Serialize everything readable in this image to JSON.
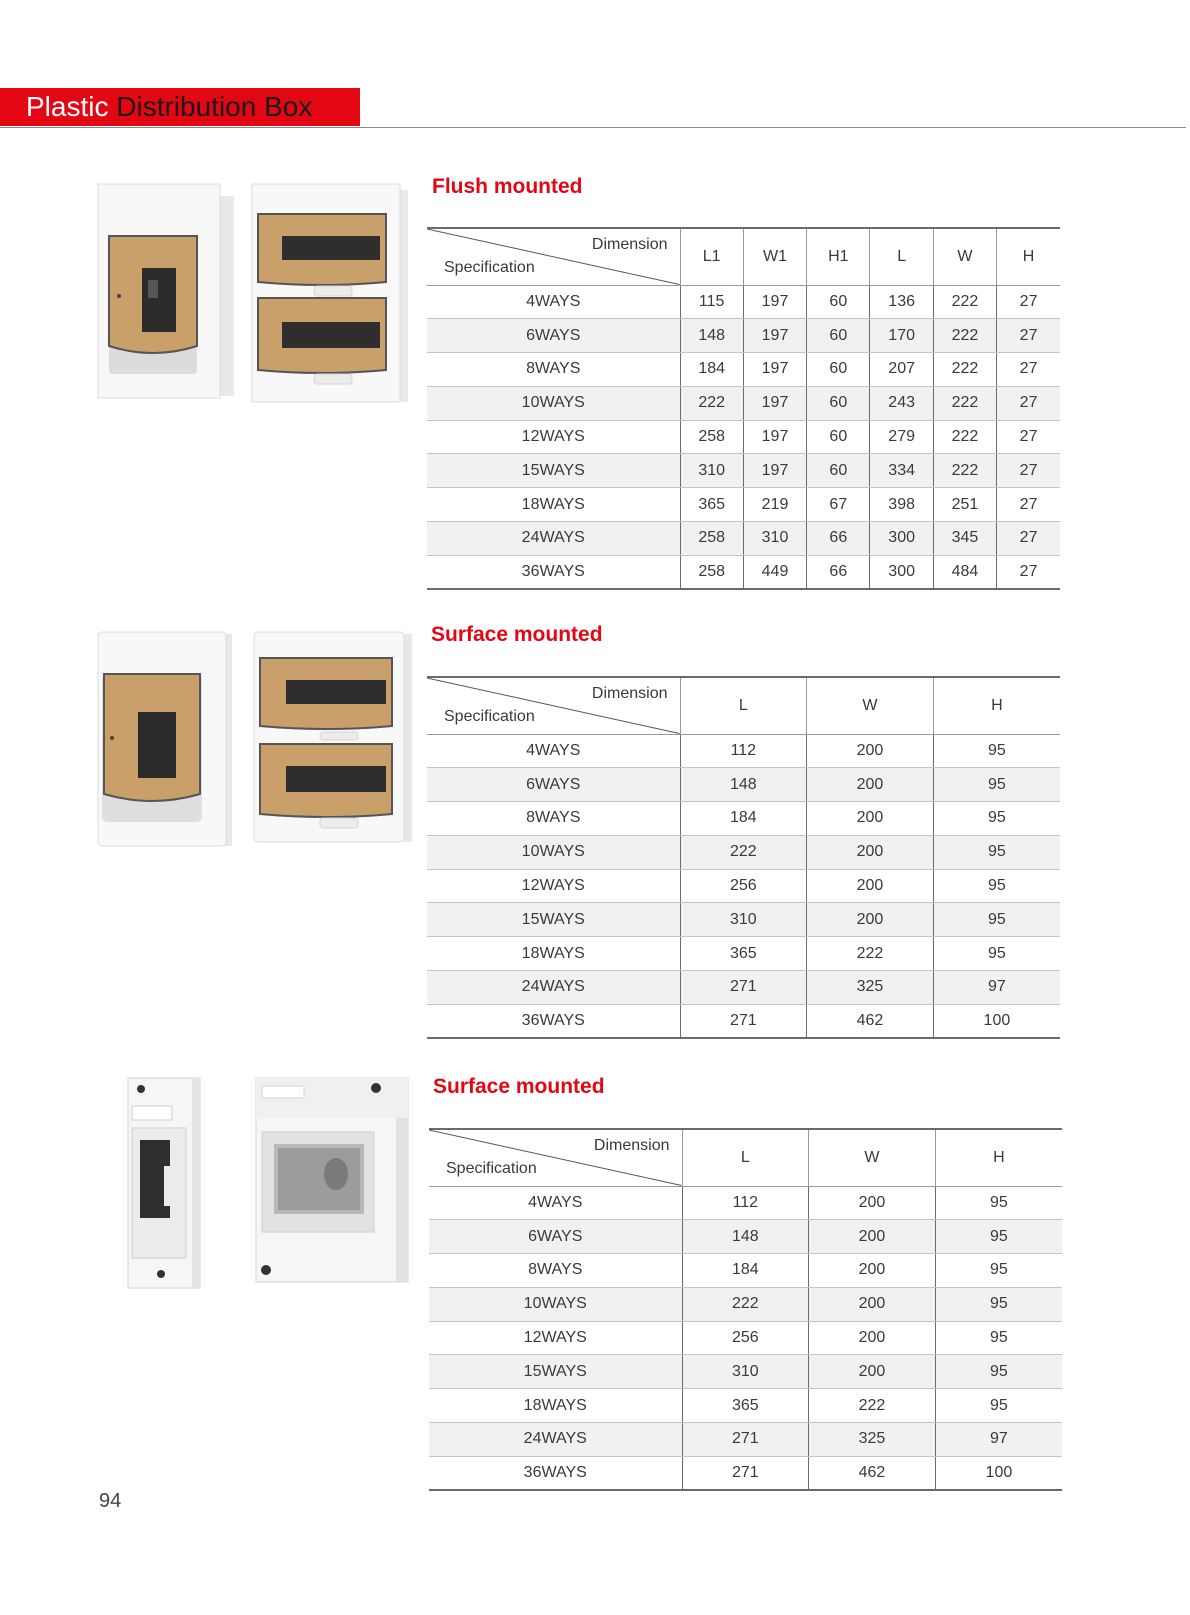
{
  "header": {
    "title_part1": "Plastic",
    "title_part2": "Distribution Box"
  },
  "sections": [
    {
      "title": "Flush mounted",
      "header_dimension": "Dimension",
      "header_specification": "Specification",
      "columns": [
        "L1",
        "W1",
        "H1",
        "L",
        "W",
        "H"
      ],
      "rows": [
        [
          "4WAYS",
          "115",
          "197",
          "60",
          "136",
          "222",
          "27"
        ],
        [
          "6WAYS",
          "148",
          "197",
          "60",
          "170",
          "222",
          "27"
        ],
        [
          "8WAYS",
          "184",
          "197",
          "60",
          "207",
          "222",
          "27"
        ],
        [
          "10WAYS",
          "222",
          "197",
          "60",
          "243",
          "222",
          "27"
        ],
        [
          "12WAYS",
          "258",
          "197",
          "60",
          "279",
          "222",
          "27"
        ],
        [
          "15WAYS",
          "310",
          "197",
          "60",
          "334",
          "222",
          "27"
        ],
        [
          "18WAYS",
          "365",
          "219",
          "67",
          "398",
          "251",
          "27"
        ],
        [
          "24WAYS",
          "258",
          "310",
          "66",
          "300",
          "345",
          "27"
        ],
        [
          "36WAYS",
          "258",
          "449",
          "66",
          "300",
          "484",
          "27"
        ]
      ]
    },
    {
      "title": "Surface mounted",
      "header_dimension": "Dimension",
      "header_specification": "Specification",
      "columns": [
        "L",
        "W",
        "H"
      ],
      "rows": [
        [
          "4WAYS",
          "112",
          "200",
          "95"
        ],
        [
          "6WAYS",
          "148",
          "200",
          "95"
        ],
        [
          "8WAYS",
          "184",
          "200",
          "95"
        ],
        [
          "10WAYS",
          "222",
          "200",
          "95"
        ],
        [
          "12WAYS",
          "256",
          "200",
          "95"
        ],
        [
          "15WAYS",
          "310",
          "200",
          "95"
        ],
        [
          "18WAYS",
          "365",
          "222",
          "95"
        ],
        [
          "24WAYS",
          "271",
          "325",
          "97"
        ],
        [
          "36WAYS",
          "271",
          "462",
          "100"
        ]
      ]
    },
    {
      "title": "Surface mounted",
      "header_dimension": "Dimension",
      "header_specification": "Specification",
      "columns": [
        "L",
        "W",
        "H"
      ],
      "rows": [
        [
          "4WAYS",
          "112",
          "200",
          "95"
        ],
        [
          "6WAYS",
          "148",
          "200",
          "95"
        ],
        [
          "8WAYS",
          "184",
          "200",
          "95"
        ],
        [
          "10WAYS",
          "222",
          "200",
          "95"
        ],
        [
          "12WAYS",
          "256",
          "200",
          "95"
        ],
        [
          "15WAYS",
          "310",
          "200",
          "95"
        ],
        [
          "18WAYS",
          "365",
          "222",
          "95"
        ],
        [
          "24WAYS",
          "271",
          "325",
          "97"
        ],
        [
          "36WAYS",
          "271",
          "462",
          "100"
        ]
      ]
    }
  ],
  "page_number": "94",
  "colors": {
    "accent": "#e30613",
    "window_tint": "#c9a06a",
    "rule": "#8a8a8a"
  }
}
